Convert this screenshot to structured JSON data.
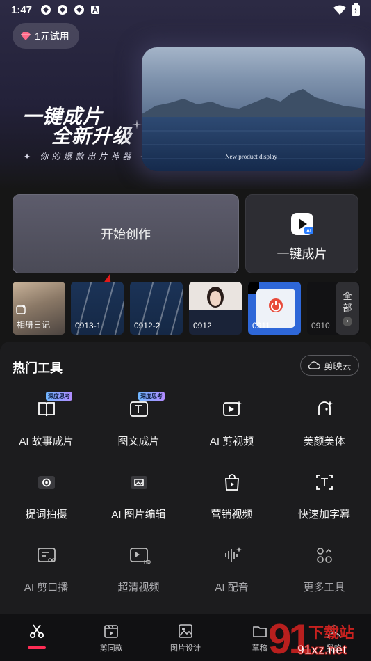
{
  "status": {
    "time": "1:47"
  },
  "hero": {
    "trial_label": "1元试用",
    "title_line1": "一键成片",
    "title_line2": "全新升级",
    "subtitle": "✦ 你的爆款出片神器 ✦",
    "photo_caption": "New product display"
  },
  "actions": {
    "start_label": "开始创作",
    "oneclick_label": "一键成片"
  },
  "drafts": [
    {
      "label": "相册日记"
    },
    {
      "label": "0913-1"
    },
    {
      "label": "0912-2"
    },
    {
      "label": "0912"
    },
    {
      "label": "0911"
    },
    {
      "label": "0910"
    }
  ],
  "all_button": {
    "line1": "全",
    "line2": "部"
  },
  "tools_section": {
    "title": "热门工具",
    "cloud_label": "剪映云",
    "tag_label": "深度思考",
    "items": [
      {
        "label": "AI 故事成片",
        "icon": "book-icon"
      },
      {
        "label": "图文成片",
        "icon": "text-image-icon"
      },
      {
        "label": "AI 剪视频",
        "icon": "ai-video-icon"
      },
      {
        "label": "美颜美体",
        "icon": "beauty-icon"
      },
      {
        "label": "提词拍摄",
        "icon": "camera-icon"
      },
      {
        "label": "AI 图片编辑",
        "icon": "image-edit-icon"
      },
      {
        "label": "营销视频",
        "icon": "shopping-bag-icon"
      },
      {
        "label": "快速加字幕",
        "icon": "caption-icon"
      },
      {
        "label": "AI 剪口播",
        "icon": "talk-cut-icon"
      },
      {
        "label": "超清视频",
        "icon": "hd-video-icon"
      },
      {
        "label": "AI 配音",
        "icon": "voice-icon"
      },
      {
        "label": "更多工具",
        "icon": "more-tools-icon"
      }
    ]
  },
  "nav": {
    "items": [
      {
        "label": "",
        "icon": "scissors-icon"
      },
      {
        "label": "剪同款",
        "icon": "template-icon"
      },
      {
        "label": "图片设计",
        "icon": "image-design-icon"
      },
      {
        "label": "草稿",
        "icon": "folder-icon"
      },
      {
        "label": "我的",
        "icon": "profile-icon"
      }
    ]
  },
  "watermark": {
    "big": "91",
    "cn": "下载站",
    "url": "91xz.net"
  },
  "colors": {
    "accent": "#ff2d55",
    "panel_bg": "#1c1c1e"
  }
}
